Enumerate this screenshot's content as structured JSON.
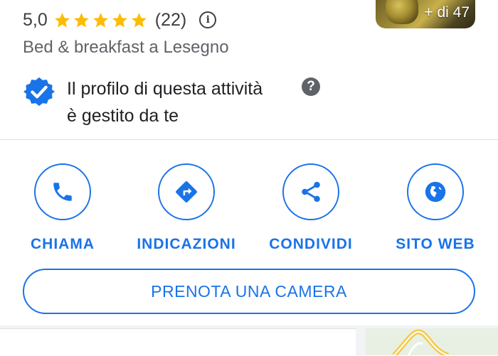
{
  "listing": {
    "rating_value": "5,0",
    "stars": 5,
    "review_count": "(22)",
    "category": "Bed & breakfast a Lesegno"
  },
  "photo": {
    "count_label": "+ di 47"
  },
  "verification": {
    "line1": "Il profilo di questa attività",
    "line2": "è gestito da te",
    "help_glyph": "?"
  },
  "actions": [
    {
      "label": "CHIAMA",
      "icon": "phone-icon"
    },
    {
      "label": "INDICAZIONI",
      "icon": "directions-icon"
    },
    {
      "label": "CONDIVIDI",
      "icon": "share-icon"
    },
    {
      "label": "SITO WEB",
      "icon": "globe-icon"
    }
  ],
  "booking": {
    "button_label": "PRENOTA UNA CAMERA"
  },
  "colors": {
    "accent": "#1a73e8",
    "star": "#fbbc04",
    "muted_text": "#5f6368",
    "divider": "#e0e0e0"
  }
}
